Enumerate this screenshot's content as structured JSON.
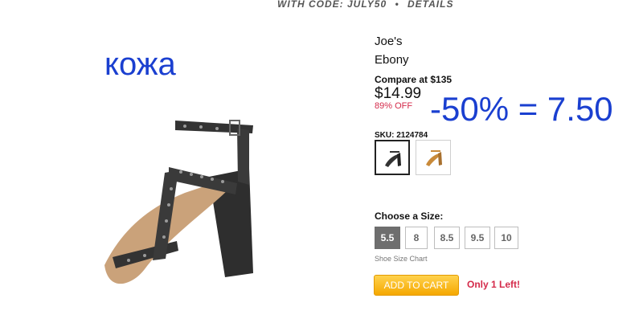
{
  "promo": {
    "text": "WITH CODE: JULY50",
    "separator": "•",
    "details_link": "DETAILS"
  },
  "annotations": {
    "material_note": "кожа",
    "discount_calc": "-50% = 7.50",
    "color": "#1a3fd0"
  },
  "product": {
    "brand": "Joe's",
    "color_name": "Ebony",
    "compare_at": "Compare at $135",
    "price": "$14.99",
    "percent_off": "89% OFF",
    "sku": "SKU: 2124784",
    "colors": [
      {
        "name": "black",
        "icon": "black-sandal-icon",
        "selected": true
      },
      {
        "name": "tan",
        "icon": "tan-sandal-icon",
        "selected": false
      }
    ]
  },
  "sizes": {
    "heading": "Choose a Size:",
    "options": [
      "5.5",
      "8",
      "8.5",
      "9.5",
      "10"
    ],
    "selected": "5.5",
    "chart_link": "Shoe Size Chart"
  },
  "cart": {
    "add_label": "ADD TO CART",
    "stock_message": "Only 1 Left!"
  },
  "colors": {
    "accent_orange": "#f5a800",
    "sale_red": "#d42a4a",
    "selected_size_bg": "#6e6e6e"
  }
}
